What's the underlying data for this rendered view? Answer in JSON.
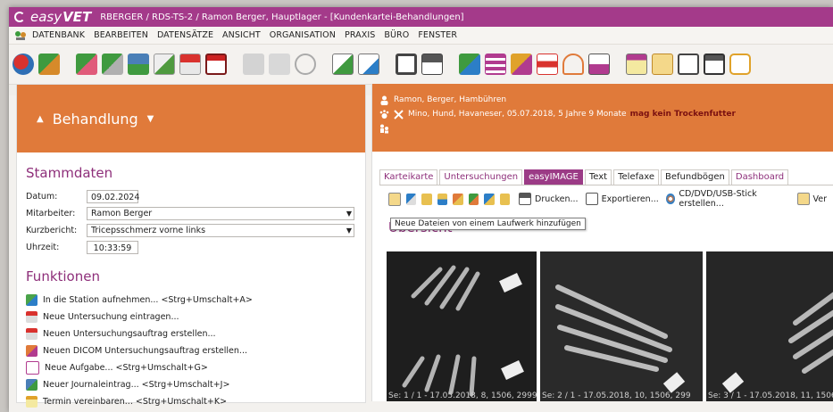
{
  "titlebar": {
    "brand_prefix": "easy",
    "brand_suffix": "VET",
    "title": "RBERGER / RDS-TS-2 / Ramon Berger, Hauptlager - [Kundenkartei-Behandlungen]"
  },
  "menu": [
    "DATENBANK",
    "BEARBEITEN",
    "DATENSÄTZE",
    "ANSICHT",
    "ORGANISATION",
    "PRAXIS",
    "BÜRO",
    "FENSTER"
  ],
  "left": {
    "header": "Behandlung",
    "stammdaten_title": "Stammdaten",
    "fields": {
      "datum_label": "Datum:",
      "datum_value": "09.02.2024",
      "mitarbeiter_label": "Mitarbeiter:",
      "mitarbeiter_value": "Ramon Berger",
      "kurzbericht_label": "Kurzbericht:",
      "kurzbericht_value": "Tricepsschmerz vorne links",
      "uhrzeit_label": "Uhrzeit:",
      "uhrzeit_value": "10:33:59"
    },
    "funktionen_title": "Funktionen",
    "functions": [
      "In die Station aufnehmen... <Strg+Umschalt+A>",
      "Neue Untersuchung eintragen...",
      "Neuen Untersuchungsauftrag erstellen...",
      "Neuen DICOM Untersuchungsauftrag erstellen...",
      "Neue Aufgabe... <Strg+Umschalt+G>",
      "Neuer Journaleintrag... <Strg+Umschalt+J>",
      "Termin vereinbaren... <Strg+Umschalt+K>"
    ]
  },
  "right": {
    "owner": "Ramon, Berger, Hambühren",
    "patient": "Mino, Hund, Havaneser, 05.07.2018, 5 Jahre 9 Monate",
    "warning": "mag kein Trockenfutter",
    "tabs": [
      "Karteikarte",
      "Untersuchungen",
      "easyIMAGE",
      "Text",
      "Telefaxe",
      "Befundbögen",
      "Dashboard"
    ],
    "toolbar": {
      "print": "Drucken...",
      "export": "Exportieren...",
      "cd": "CD/DVD/USB-Stick erstellen...",
      "more": "Ver"
    },
    "tooltip": "Neue Dateien von einem Laufwerk hinzufügen",
    "overview_title": "Übersicht",
    "images": [
      {
        "caption": "Se: 1 / 1 - 17.05.2018, 8, 1506, 2999"
      },
      {
        "caption": "Se: 2 / 1 - 17.05.2018, 10, 1506, 299"
      },
      {
        "caption": "Se: 3 / 1 - 17.05.2018, 11, 1506, 299"
      }
    ]
  },
  "colors": {
    "accent": "#a43a8a",
    "orange": "#e07a3a",
    "warning": "#7a1010"
  }
}
